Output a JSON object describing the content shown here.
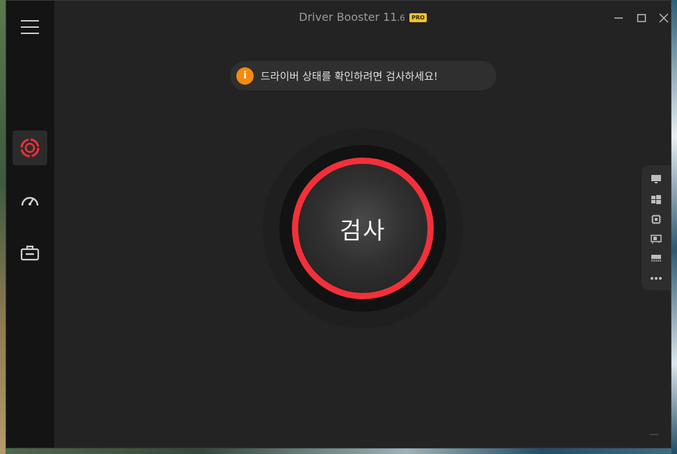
{
  "window": {
    "title_main": "Driver Booster 11",
    "title_version": ".6",
    "badge": "PRO"
  },
  "notice": {
    "icon": "info-icon",
    "icon_glyph": "i",
    "text": "드라이버 상태를 확인하려면 검사하세요!"
  },
  "scan": {
    "label": "검사",
    "ring_color": "#f3303a"
  },
  "sidebar": {
    "items": [
      {
        "name": "scan",
        "icon": "driver-scan-icon",
        "active": true
      },
      {
        "name": "boost",
        "icon": "speedometer-icon",
        "active": false
      },
      {
        "name": "toolbox",
        "icon": "toolbox-icon",
        "active": false
      }
    ]
  },
  "device_panel": {
    "items": [
      "monitor-icon",
      "windows-icon",
      "chip-icon",
      "network-card-icon",
      "memory-icon",
      "more-icon"
    ]
  },
  "colors": {
    "accent_red": "#f3303a",
    "info_orange": "#f58a10",
    "pro_gold": "#f1c232"
  }
}
